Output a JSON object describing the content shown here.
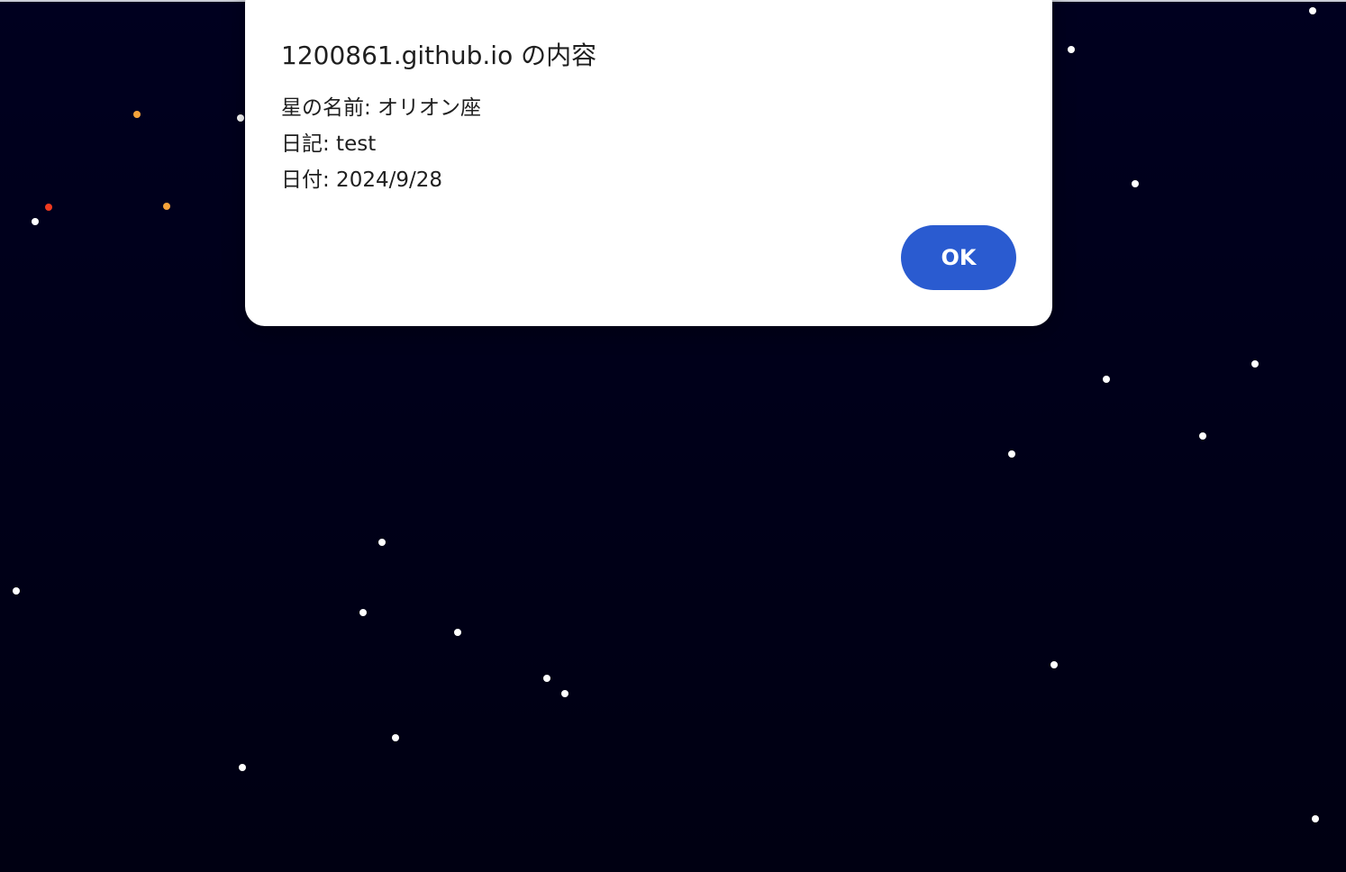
{
  "dialog": {
    "title": "1200861.github.io の内容",
    "lines": [
      "星の名前: オリオン座",
      "日記: test",
      "日付: 2024/9/28"
    ],
    "ok_label": "OK"
  },
  "colors": {
    "sky": "#000019",
    "star_white": "#ffffff",
    "star_orange": "#f5a23a",
    "star_red": "#ef3a1f",
    "ok_button": "#2a5bd0"
  }
}
